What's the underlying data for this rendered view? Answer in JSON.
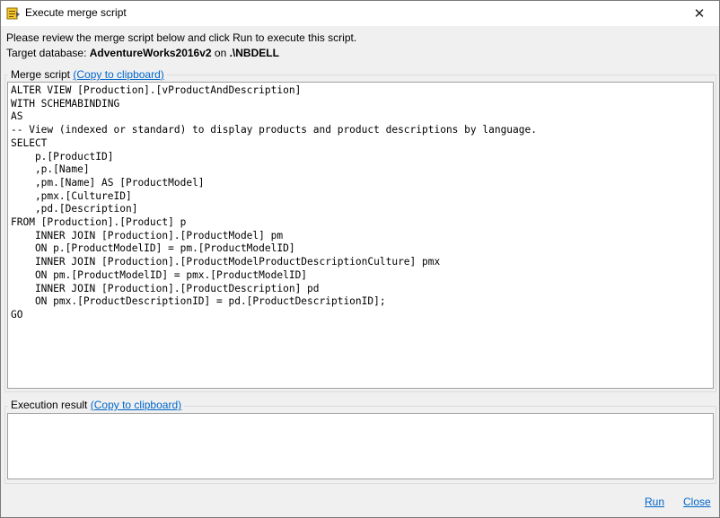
{
  "window": {
    "title": "Execute merge script",
    "close_glyph": "✕"
  },
  "instructions": "Please review the merge script below and click Run to execute this script.",
  "target": {
    "prefix": "Target database: ",
    "database": "AdventureWorks2016v2",
    "on_word": " on ",
    "server": ".\\NBDELL"
  },
  "merge_script": {
    "label": "Merge script",
    "copy_link": "(Copy to clipboard)",
    "code": "ALTER VIEW [Production].[vProductAndDescription]\nWITH SCHEMABINDING\nAS\n-- View (indexed or standard) to display products and product descriptions by language.\nSELECT\n    p.[ProductID]\n    ,p.[Name]\n    ,pm.[Name] AS [ProductModel]\n    ,pmx.[CultureID]\n    ,pd.[Description]\nFROM [Production].[Product] p\n    INNER JOIN [Production].[ProductModel] pm\n    ON p.[ProductModelID] = pm.[ProductModelID]\n    INNER JOIN [Production].[ProductModelProductDescriptionCulture] pmx\n    ON pm.[ProductModelID] = pmx.[ProductModelID]\n    INNER JOIN [Production].[ProductDescription] pd\n    ON pmx.[ProductDescriptionID] = pd.[ProductDescriptionID];\nGO"
  },
  "execution_result": {
    "label": "Execution result",
    "copy_link": "(Copy to clipboard)",
    "text": ""
  },
  "actions": {
    "run": "Run",
    "close": "Close"
  },
  "colors": {
    "link": "#0066cc",
    "background": "#f0f0f0",
    "border": "#a0a0a0"
  },
  "icons": {
    "app": "script-icon",
    "close": "close-icon"
  }
}
